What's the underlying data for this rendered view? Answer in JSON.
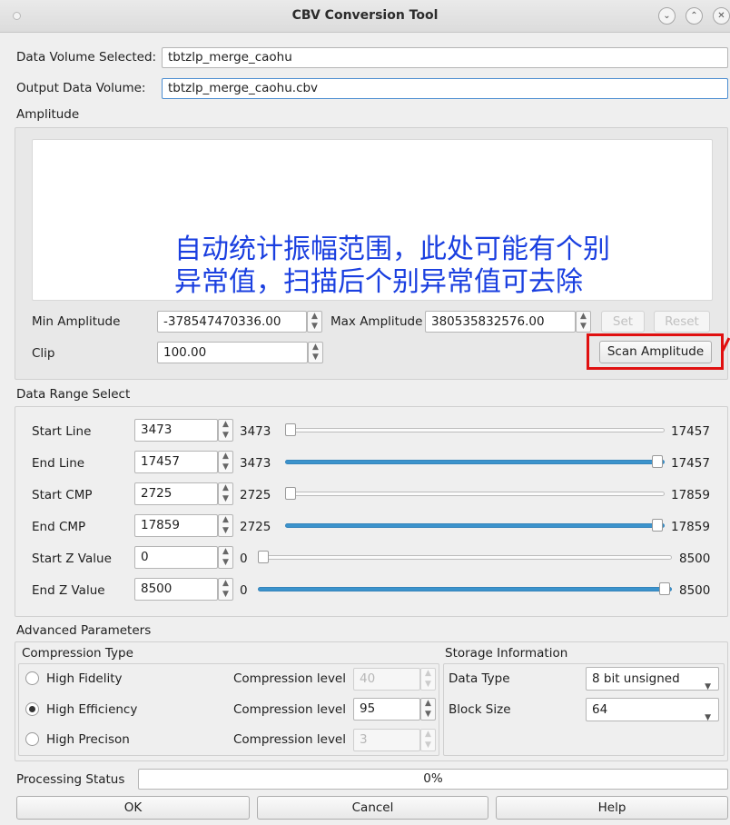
{
  "window": {
    "title": "CBV Conversion Tool",
    "btn_minimize": "⌄",
    "btn_maximize": "⌃",
    "btn_close": "✕"
  },
  "io": {
    "data_volume_label": "Data Volume Selected:",
    "data_volume_value": "tbtzlp_merge_caohu",
    "output_volume_label": "Output Data Volume:",
    "output_volume_value": "tbtzlp_merge_caohu.cbv"
  },
  "amplitude": {
    "section_label": "Amplitude",
    "annotation_line1": "自动统计振幅范围，此处可能有个别",
    "annotation_line2": "异常值，扫描后个别异常值可去除",
    "min_label": "Min Amplitude",
    "min_value": "-378547470336.00",
    "max_label": "Max Amplitude",
    "max_value": "380535832576.00",
    "set_label": "Set",
    "reset_label": "Reset",
    "clip_label": "Clip",
    "clip_value": "100.00",
    "scan_label": "Scan Amplitude"
  },
  "range": {
    "section_label": "Data Range Select",
    "rows": [
      {
        "label": "Start Line",
        "value": "3473",
        "min": "3473",
        "max": "17457",
        "fraction": 0.0
      },
      {
        "label": "End Line",
        "value": "17457",
        "min": "3473",
        "max": "17457",
        "fraction": 1.0
      },
      {
        "label": "Start CMP",
        "value": "2725",
        "min": "2725",
        "max": "17859",
        "fraction": 0.0
      },
      {
        "label": "End CMP",
        "value": "17859",
        "min": "2725",
        "max": "17859",
        "fraction": 1.0
      },
      {
        "label": "Start Z Value",
        "value": "0",
        "min": "0",
        "max": "8500",
        "fraction": 0.0
      },
      {
        "label": "End Z Value",
        "value": "8500",
        "min": "0",
        "max": "8500",
        "fraction": 1.0
      }
    ]
  },
  "advanced": {
    "section_label": "Advanced Parameters",
    "compression_label": "Compression Type",
    "options": [
      {
        "label": "High Fidelity",
        "level_label": "Compression level",
        "level_value": "40",
        "checked": false,
        "enabled": false
      },
      {
        "label": "High Efficiency",
        "level_label": "Compression level",
        "level_value": "95",
        "checked": true,
        "enabled": true
      },
      {
        "label": "High Precison",
        "level_label": "Compression level",
        "level_value": "3",
        "checked": false,
        "enabled": false
      }
    ],
    "storage_label": "Storage Information",
    "data_type_label": "Data Type",
    "data_type_value": "8 bit unsigned",
    "block_size_label": "Block Size",
    "block_size_value": "64"
  },
  "status": {
    "label": "Processing Status",
    "progress_text": "0%",
    "progress": 0
  },
  "buttons": {
    "ok": "OK",
    "cancel": "Cancel",
    "help": "Help"
  },
  "colors": {
    "annotation": "#1a3fe0",
    "highlight": "#e01010",
    "slider_fill": "#3b93cc"
  }
}
